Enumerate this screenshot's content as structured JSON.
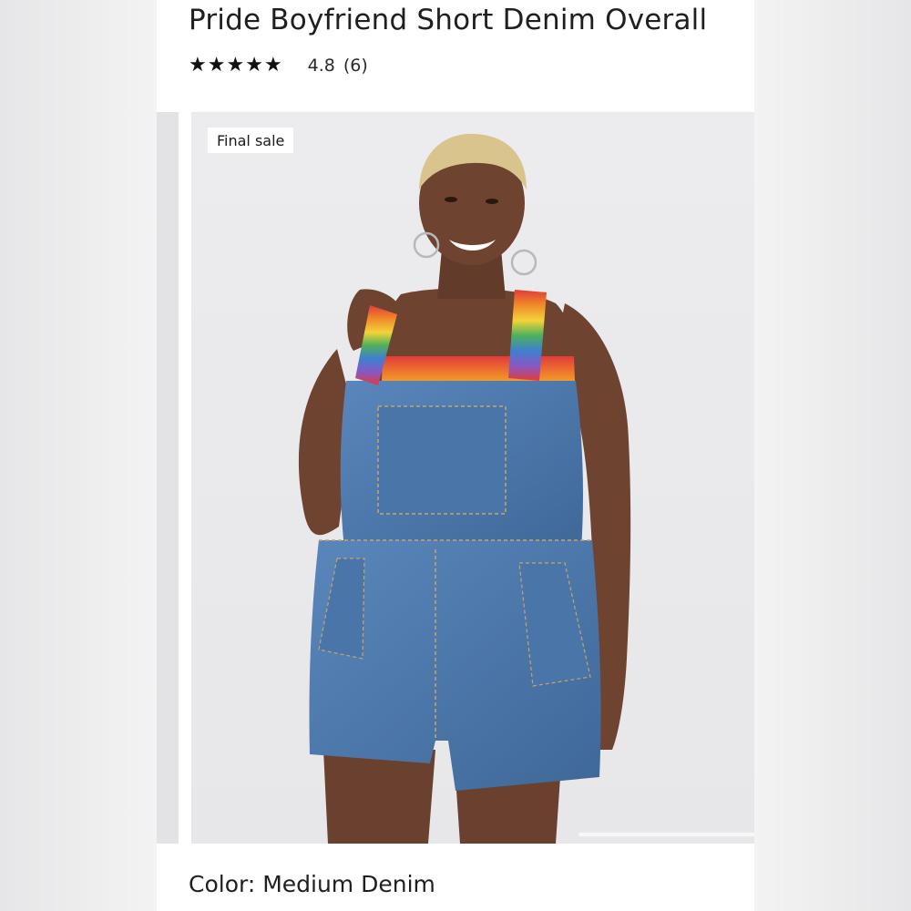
{
  "product": {
    "title": "Pride Boyfriend Short Denim Overall",
    "rating": {
      "stars_filled": 5,
      "stars_total": 5,
      "value": "4.8",
      "count": "(6)"
    },
    "badge": "Final sale",
    "color_prefix": "Color:",
    "color_value": "Medium Denim",
    "color_text": "Color: Medium Denim"
  },
  "icons": {
    "star": "star-icon"
  },
  "colors": {
    "denim": "#4f7bb0",
    "denim_dark": "#3d6697",
    "skin": "#6e4330",
    "hair": "#d8c48c",
    "background": "#ececee"
  }
}
